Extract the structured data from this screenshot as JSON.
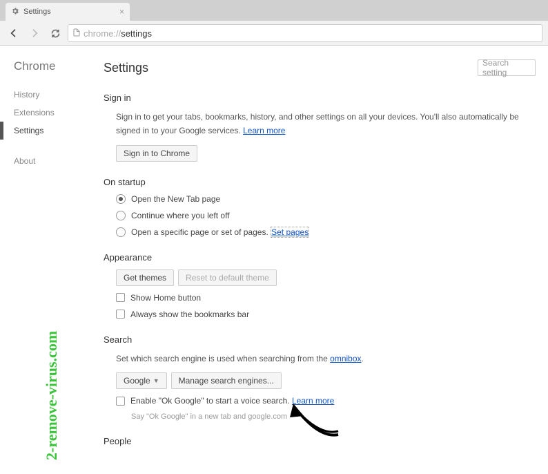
{
  "tab": {
    "title": "Settings"
  },
  "url": {
    "protocol": "chrome://",
    "path": "settings"
  },
  "sidebar": {
    "title": "Chrome",
    "items": [
      {
        "label": "History",
        "selected": false
      },
      {
        "label": "Extensions",
        "selected": false
      },
      {
        "label": "Settings",
        "selected": true
      }
    ],
    "about": "About"
  },
  "header": {
    "title": "Settings",
    "search_placeholder": "Search setting"
  },
  "signin": {
    "heading": "Sign in",
    "desc": "Sign in to get your tabs, bookmarks, history, and other settings on all your devices. You'll also automatically be signed in to your Google services. ",
    "learn_more": "Learn more",
    "button": "Sign in to Chrome"
  },
  "startup": {
    "heading": "On startup",
    "opt1": "Open the New Tab page",
    "opt2": "Continue where you left off",
    "opt3": "Open a specific page or set of pages. ",
    "set_pages": "Set pages"
  },
  "appearance": {
    "heading": "Appearance",
    "get_themes": "Get themes",
    "reset_theme": "Reset to default theme",
    "show_home": "Show Home button",
    "show_bookmarks": "Always show the bookmarks bar"
  },
  "search": {
    "heading": "Search",
    "desc1": "Set which search engine is used when searching from the ",
    "omnibox": "omnibox",
    "engine": "Google",
    "manage": "Manage search engines...",
    "enable_ok": "Enable \"Ok Google\" to start a voice search. ",
    "learn_more": "Learn more",
    "subtext": "Say \"Ok Google\" in a new tab and google.com"
  },
  "people": {
    "heading": "People"
  },
  "watermark": "2-remove-virus.com"
}
